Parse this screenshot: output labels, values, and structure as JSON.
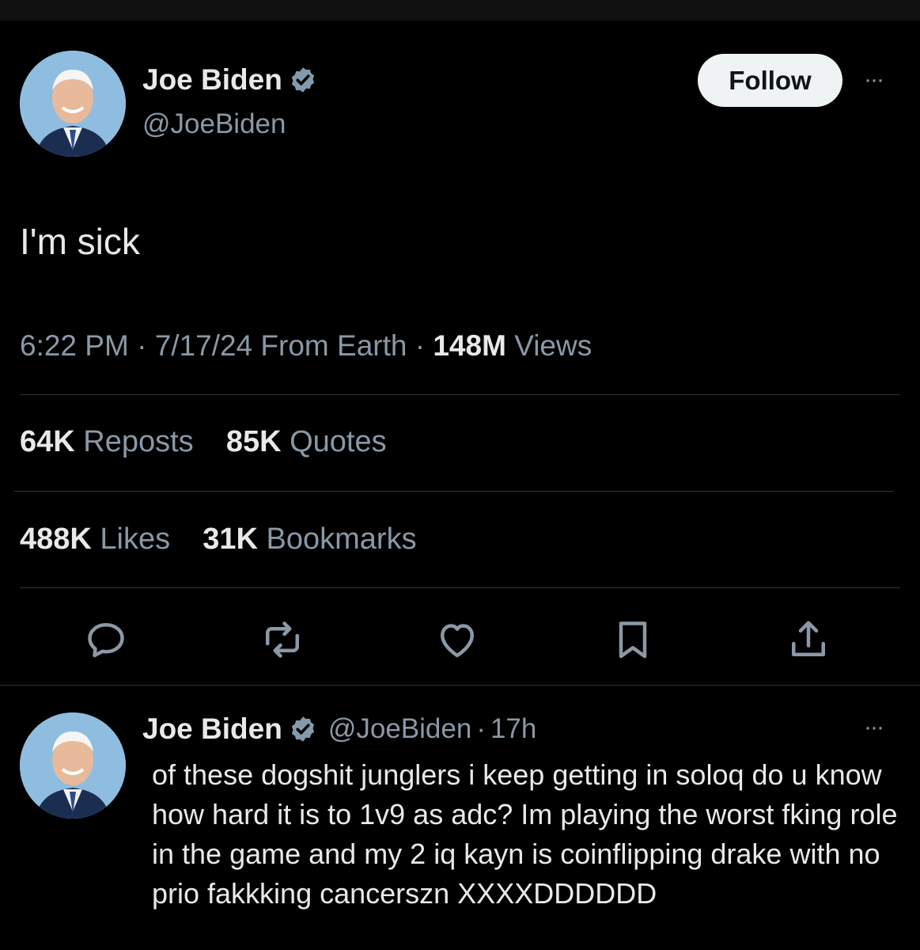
{
  "tweet": {
    "author_name": "Joe Biden",
    "author_handle": "@JoeBiden",
    "follow_label": "Follow",
    "more_label": "···",
    "text": "I'm sick",
    "time": "6:22 PM",
    "date": "7/17/24",
    "location": "From Earth",
    "separator": "·",
    "views_count": "148M",
    "views_label": "Views",
    "reposts_count": "64K",
    "reposts_label": "Reposts",
    "quotes_count": "85K",
    "quotes_label": "Quotes",
    "likes_count": "488K",
    "likes_label": "Likes",
    "bookmarks_count": "31K",
    "bookmarks_label": "Bookmarks"
  },
  "actions": [
    {
      "icon": "reply-icon"
    },
    {
      "icon": "repost-icon"
    },
    {
      "icon": "like-icon"
    },
    {
      "icon": "bookmark-icon"
    },
    {
      "icon": "share-icon"
    }
  ],
  "reply": {
    "author_name": "Joe Biden",
    "author_handle": "@JoeBiden",
    "separator": "·",
    "time_ago": "17h",
    "more_label": "···",
    "text": "of these dogshit junglers i keep getting in soloq do u know how hard it is to 1v9 as adc? Im playing the worst fking role in the game and my 2 iq kayn is coinflipping drake with no prio fakkking cancerszn XXXXDDDDDD"
  },
  "colors": {
    "background": "#000000",
    "text_primary": "#e7e9ea",
    "text_secondary": "#8b98a5",
    "divider": "#2f3336",
    "verified_badge": "#829aab",
    "follow_button_bg": "#eff3f4"
  }
}
